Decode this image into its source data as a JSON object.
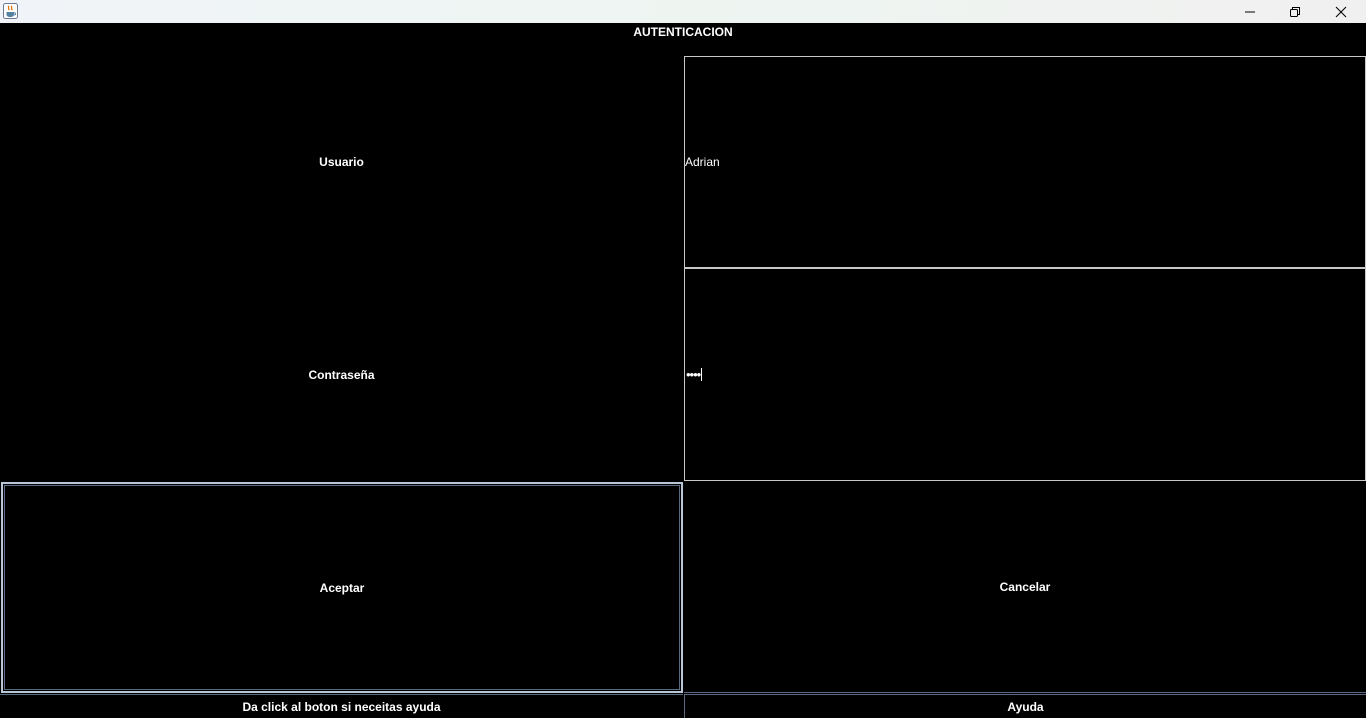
{
  "window": {
    "icon": "java-cup-icon",
    "controls": [
      "minimize-icon",
      "maximize-icon",
      "close-icon"
    ]
  },
  "form": {
    "heading": "AUTENTICACION",
    "user_label": "Usuario",
    "user_value": "Adrian",
    "password_label": "Contraseña",
    "password_mask": "••••"
  },
  "buttons": {
    "accept": "Aceptar",
    "cancel": "Cancelar",
    "help": "Ayuda"
  },
  "help_text": "Da click al boton si neceitas ayuda",
  "colors": {
    "background": "#000000",
    "text": "#ffffff",
    "field_border": "#c8c8c8",
    "focus_border": "#b9c6d8"
  }
}
